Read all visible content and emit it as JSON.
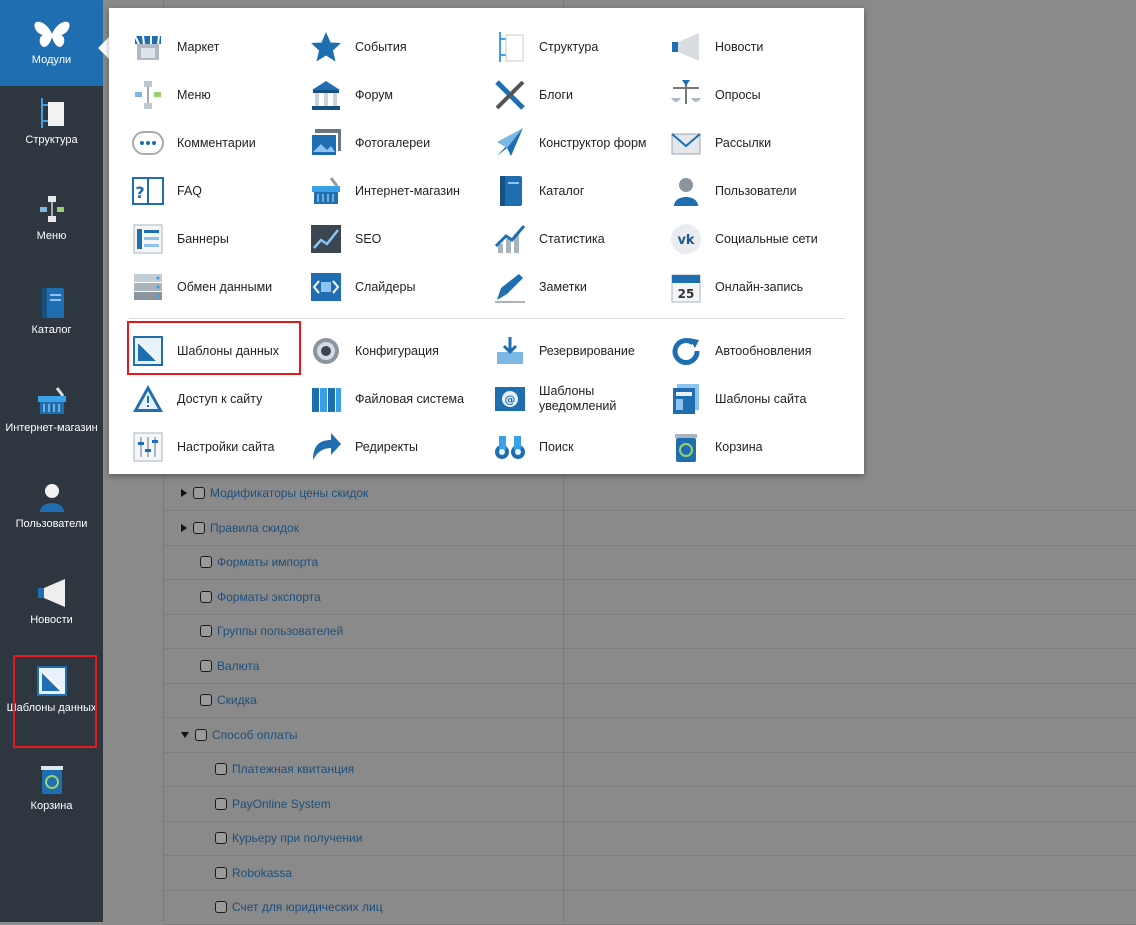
{
  "sidebar": {
    "items": [
      {
        "id": "modules",
        "label": "Модули",
        "active": true
      },
      {
        "id": "structure",
        "label": "Структура"
      },
      {
        "id": "menu",
        "label": "Меню"
      },
      {
        "id": "catalog",
        "label": "Каталог"
      },
      {
        "id": "shop",
        "label": "Интернет-магазин"
      },
      {
        "id": "users",
        "label": "Пользователи"
      },
      {
        "id": "news",
        "label": "Новости"
      },
      {
        "id": "data-templates",
        "label": "Шаблоны данных",
        "highlighted": true
      },
      {
        "id": "trash",
        "label": "Корзина"
      }
    ],
    "labels": {
      "modules": "Модули",
      "structure": "Структура",
      "menu": "Меню",
      "catalog": "Каталог",
      "shop": "Интернет-магазин",
      "users": "Пользователи",
      "news": "Новости",
      "data_templates": "Шаблоны данных",
      "trash": "Корзина"
    }
  },
  "popup": {
    "group1": [
      {
        "label": "Маркет",
        "icon": "market-stall-icon"
      },
      {
        "label": "События",
        "icon": "star-icon"
      },
      {
        "label": "Структура",
        "icon": "structure-icon"
      },
      {
        "label": "Новости",
        "icon": "megaphone-icon"
      },
      {
        "label": "Меню",
        "icon": "menu-tree-icon"
      },
      {
        "label": "Форум",
        "icon": "building-icon"
      },
      {
        "label": "Блоги",
        "icon": "pen-pencil-icon"
      },
      {
        "label": "Опросы",
        "icon": "scales-icon"
      },
      {
        "label": "Комментарии",
        "icon": "speech-bubble-icon"
      },
      {
        "label": "Фотогалереи",
        "icon": "photo-gallery-icon"
      },
      {
        "label": "Конструктор форм",
        "icon": "paper-plane-icon"
      },
      {
        "label": "Рассылки",
        "icon": "envelope-icon"
      },
      {
        "label": "FAQ",
        "icon": "book-question-icon"
      },
      {
        "label": "Интернет-магазин",
        "icon": "shopping-basket-icon"
      },
      {
        "label": "Каталог",
        "icon": "catalog-book-icon"
      },
      {
        "label": "Пользователи",
        "icon": "user-icon"
      },
      {
        "label": "Баннеры",
        "icon": "banners-icon"
      },
      {
        "label": "SEO",
        "icon": "seo-chart-icon"
      },
      {
        "label": "Статистика",
        "icon": "statistics-icon"
      },
      {
        "label": "Социальные сети",
        "icon": "vk-icon"
      },
      {
        "label": "Обмен данными",
        "icon": "server-icon"
      },
      {
        "label": "Слайдеры",
        "icon": "slider-icon"
      },
      {
        "label": "Заметки",
        "icon": "notes-icon"
      },
      {
        "label": "Онлайн-запись",
        "icon": "calendar-icon"
      }
    ],
    "group2": [
      {
        "label": "Шаблоны данных",
        "icon": "data-templates-icon",
        "highlighted": true
      },
      {
        "label": "Конфигурация",
        "icon": "gear-icon"
      },
      {
        "label": "Резервирование",
        "icon": "backup-icon"
      },
      {
        "label": "Автообновления",
        "icon": "refresh-icon"
      },
      {
        "label": "Доступ к сайту",
        "icon": "warning-sign-icon"
      },
      {
        "label": "Файловая система",
        "icon": "file-system-icon"
      },
      {
        "label": "Шаблоны уведомлений",
        "icon": "notification-envelope-icon"
      },
      {
        "label": "Шаблоны сайта",
        "icon": "site-templates-icon"
      },
      {
        "label": "Настройки сайта",
        "icon": "settings-sliders-icon"
      },
      {
        "label": "Редиректы",
        "icon": "redirect-arrow-icon"
      },
      {
        "label": "Поиск",
        "icon": "binoculars-icon"
      },
      {
        "label": "Корзина",
        "icon": "trash-icon"
      }
    ]
  },
  "tree": {
    "rows": [
      {
        "label": "Модификаторы цены скидок",
        "level": 1,
        "toggle": "collapsed"
      },
      {
        "label": "Правила скидок",
        "level": 1,
        "toggle": "collapsed"
      },
      {
        "label": "Форматы импорта",
        "level": 1,
        "toggle": "none"
      },
      {
        "label": "Форматы экспорта",
        "level": 1,
        "toggle": "none"
      },
      {
        "label": "Группы пользователей",
        "level": 1,
        "toggle": "none"
      },
      {
        "label": "Валюта",
        "level": 1,
        "toggle": "none"
      },
      {
        "label": "Скидка",
        "level": 1,
        "toggle": "none"
      },
      {
        "label": "Способ оплаты",
        "level": 1,
        "toggle": "expanded"
      },
      {
        "label": "Платежная квитанция",
        "level": 2,
        "toggle": "none"
      },
      {
        "label": "PayOnline System",
        "level": 2,
        "toggle": "none"
      },
      {
        "label": "Курьеру при получении",
        "level": 2,
        "toggle": "none"
      },
      {
        "label": "Robokassa",
        "level": 2,
        "toggle": "none"
      },
      {
        "label": "Счет для юридических лиц",
        "level": 2,
        "toggle": "none"
      }
    ]
  },
  "colors": {
    "sidebar_bg": "#2e3640",
    "sidebar_active": "#1f6eb1",
    "highlight_border": "#e3191b",
    "tree_link": "#1d4f7c"
  }
}
